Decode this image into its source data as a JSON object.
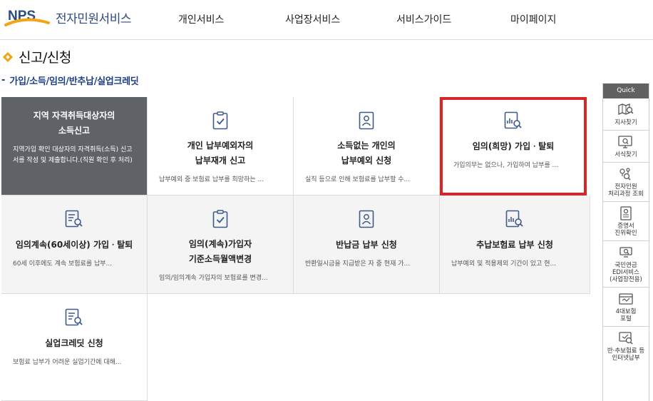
{
  "header": {
    "logo_text": "NPS",
    "service_name": "전자민원서비스",
    "nav": [
      "개인서비스",
      "사업장서비스",
      "서비스가이드",
      "마이페이지"
    ]
  },
  "page": {
    "title": "신고/신청",
    "subtitle": "가입/소득/임의/반추납/실업크레딧"
  },
  "cards": [
    {
      "title": "지역 자격취득대상자의\n소득신고",
      "desc": "지역가입 확인 대상자의 자격취득(소득) 신고서를 작성 및 제출합니다.(직원 확인 후 처리)",
      "icon": "none"
    },
    {
      "title": "개인 납부예외자의\n납부재개 신고",
      "desc": "납부예외 중 보험료 납부를 희망하는 ...",
      "icon": "clipboard-check-icon"
    },
    {
      "title": "소득없는 개인의\n납부예외 신청",
      "desc": "실직 등으로 인해 보험료를 납부할 수...",
      "icon": "person-card-icon"
    },
    {
      "title": "임의(희망) 가입ㆍ탈퇴",
      "desc": "가입의무는 없으나, 가입하여 납부를 ...",
      "icon": "chart-search-icon"
    },
    {
      "title": "임의계속(60세이상) 가입ㆍ탈퇴",
      "desc": "60세 이후에도 계속 보험료를 납부...",
      "icon": "document-search-icon"
    },
    {
      "title": "임의(계속)가입자\n기준소득월액변경",
      "desc": "임의/임의계속 가입자의 보험료를 변경...",
      "icon": "clipboard-check-icon"
    },
    {
      "title": "반납금 납부 신청",
      "desc": "반환일시금을 지급받은 자 중 현재 가...",
      "icon": "person-card-icon"
    },
    {
      "title": "추납보험료 납부 신청",
      "desc": "납부예외 및 적용제외 기간이 있고 현...",
      "icon": "chart-search-icon"
    },
    {
      "title": "실업크레딧 신청",
      "desc": "보험료 납부가 어려운 실업기간에 대해...",
      "icon": "document-search-icon"
    }
  ],
  "quick": {
    "title": "Quick",
    "items": [
      {
        "label": "지사찾기",
        "icon": "map-search-icon"
      },
      {
        "label": "서식찾기",
        "icon": "monitor-search-icon"
      },
      {
        "label": "전자민원\n처리과정 조회",
        "icon": "process-search-icon"
      },
      {
        "label": "증명서\n진위확인",
        "icon": "certificate-check-icon"
      },
      {
        "label": "국민연금\nEDI서비스\n(사업장전용)",
        "icon": "edi-service-icon"
      },
      {
        "label": "4대보험\n포털",
        "icon": "insurance-portal-icon"
      },
      {
        "label": "반·추보험료 등\n인터넷납부",
        "icon": "internet-payment-icon"
      }
    ]
  },
  "colors": {
    "brand_navy": "#2b4a86",
    "brand_orange": "#f0a516",
    "highlight_red": "#d7262a",
    "dark_card": "#5f6368",
    "icon_blue": "#3e5a8c"
  }
}
